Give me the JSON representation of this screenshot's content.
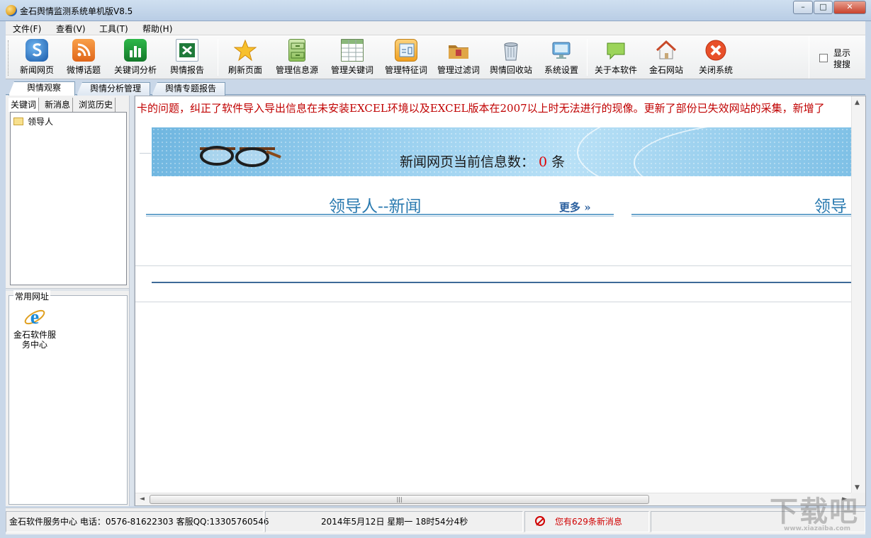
{
  "window": {
    "title": "金石舆情监测系统单机版V8.5",
    "controls": {
      "minimize": "–",
      "maximize": "□",
      "close": "✕"
    }
  },
  "menu": [
    "文件(F)",
    "查看(V)",
    "工具(T)",
    "帮助(H)"
  ],
  "toolbar": {
    "buttons": [
      {
        "id": "news",
        "label": "新闻网页",
        "icon": "news-web-icon"
      },
      {
        "id": "weibo",
        "label": "微博话题",
        "icon": "rss-icon"
      },
      {
        "id": "keyword",
        "label": "关键词分析",
        "icon": "bar-chart-icon"
      },
      {
        "id": "report",
        "label": "舆情报告",
        "icon": "excel-icon"
      },
      {
        "id": "refresh",
        "label": "刷新页面",
        "icon": "star-icon"
      },
      {
        "id": "source",
        "label": "管理信息源",
        "icon": "cabinet-icon"
      },
      {
        "id": "keywords",
        "label": "管理关键词",
        "icon": "table-icon"
      },
      {
        "id": "feature",
        "label": "管理特征词",
        "icon": "feature-icon"
      },
      {
        "id": "filter",
        "label": "管理过滤词",
        "icon": "folder-icon"
      },
      {
        "id": "recycle",
        "label": "舆情回收站",
        "icon": "recycle-bin-icon"
      },
      {
        "id": "settings",
        "label": "系统设置",
        "icon": "monitor-icon"
      },
      {
        "id": "about",
        "label": "关于本软件",
        "icon": "chat-icon"
      },
      {
        "id": "website",
        "label": "金石网站",
        "icon": "home-icon"
      },
      {
        "id": "exit",
        "label": "关闭系统",
        "icon": "close-circle-icon"
      }
    ],
    "show_search": "显示搜搜"
  },
  "tabs": [
    "舆情观察",
    "舆情分析管理",
    "舆情专题报告"
  ],
  "left": {
    "subtabs": [
      "关键词",
      "新消息",
      "浏览历史"
    ],
    "tree": [
      {
        "label": "领导人",
        "icon": "folder-icon"
      }
    ],
    "favorites_title": "常用网址",
    "favorites": [
      {
        "label": "金石软件服务中心",
        "icon": "ie-icon"
      }
    ]
  },
  "main": {
    "marquee": "卡的问题，纠正了软件导入导出信息在未安装EXCEL环境以及EXCEL版本在2007以上时无法进行的现像。更新了部份已失效网站的采集，新增了",
    "banner": {
      "prefix": "新闻网页当前信息数：",
      "count": "0",
      "suffix": "条"
    },
    "section_left": "领导人--新闻",
    "more": "更多 »",
    "section_right": "领导"
  },
  "status": {
    "contact": "金石软件服务中心 电话：0576-81622303  客服QQ:13305760546",
    "datetime": "2014年5月12日   星期一    18时54分4秒",
    "messages": "您有629条新消息"
  },
  "watermark": {
    "main": "下载吧",
    "sub": "www.xiazaiba.com"
  }
}
